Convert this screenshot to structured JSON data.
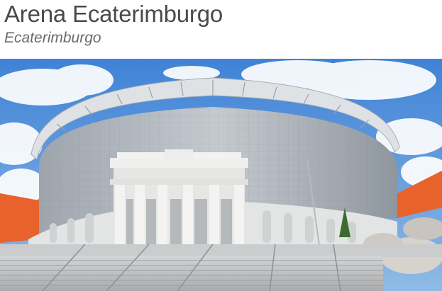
{
  "header": {
    "title": "Arena Ecaterimburgo",
    "subtitle": "Ecaterimburgo"
  },
  "photo": {
    "subject": "stadium-photo",
    "colors": {
      "sky": "#4f8fd8",
      "cloud": "#ffffff",
      "facade": "#c9ccd0",
      "roof": "#d9dcdf",
      "stands": "#e8632b",
      "steps": "#bfc1c3"
    }
  }
}
